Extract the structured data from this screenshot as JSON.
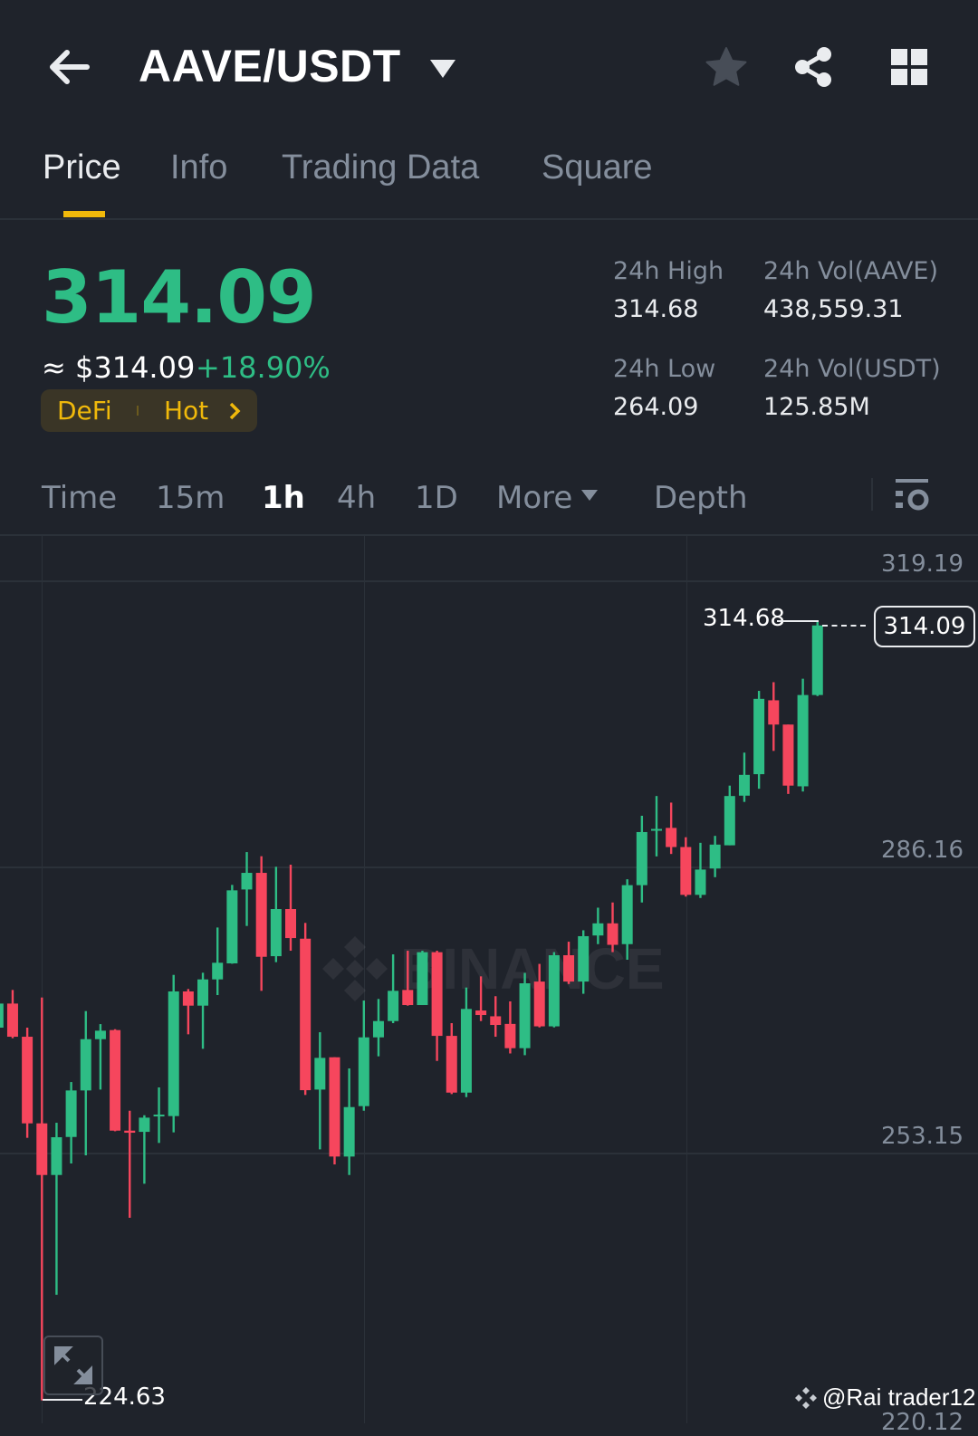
{
  "header": {
    "title": "AAVE/USDT",
    "icons": [
      "back-arrow-icon",
      "dropdown-caret-icon",
      "star-icon",
      "share-icon",
      "grid-icon"
    ]
  },
  "tabs": [
    {
      "label": "Price",
      "active": true
    },
    {
      "label": "Info"
    },
    {
      "label": "Trading Data"
    },
    {
      "label": "Square"
    }
  ],
  "ticker": {
    "last_price": "314.09",
    "approx_usd": "≈ $314.09",
    "change_pct": "+18.90%",
    "tags": [
      "DeFi",
      "Hot"
    ],
    "stats": {
      "high_label": "24h High",
      "high_value": "314.68",
      "low_label": "24h Low",
      "low_value": "264.09",
      "vol_base_label": "24h Vol(AAVE)",
      "vol_base_value": "438,559.31",
      "vol_quote_label": "24h Vol(USDT)",
      "vol_quote_value": "125.85M"
    }
  },
  "intervals": [
    {
      "label": "Time"
    },
    {
      "label": "15m"
    },
    {
      "label": "1h",
      "active": true
    },
    {
      "label": "4h"
    },
    {
      "label": "1D"
    },
    {
      "label": "More"
    },
    {
      "label": "Depth"
    }
  ],
  "colors": {
    "up": "#2ebd85",
    "down": "#f6465d",
    "accent": "#f0b90b",
    "bg": "#1f232b"
  },
  "chart": {
    "watermark": "BINANCE",
    "axis_labels": [
      "319.19",
      "286.16",
      "253.15",
      "220.12"
    ],
    "current_price_label": "314.09",
    "high_marker": "314.68",
    "low_marker": "224.63",
    "credit": "@Rai trader12"
  },
  "chart_data": {
    "type": "candlestick",
    "interval": "1h",
    "ylim": [
      220.12,
      321.5
    ],
    "y_ticks": [
      319.19,
      286.16,
      253.15,
      220.12
    ],
    "ohlc": [
      [
        267.66,
        270.44,
        267.66,
        270.44
      ],
      [
        270.44,
        272.01,
        266.44,
        266.61
      ],
      [
        266.61,
        267.66,
        254.94,
        256.61
      ],
      [
        256.61,
        271.14,
        224.63,
        250.65
      ],
      [
        250.65,
        256.68,
        236.82,
        255.01
      ],
      [
        255.04,
        261.38,
        251.98,
        260.41
      ],
      [
        260.41,
        269.57,
        252.92,
        266.33
      ],
      [
        266.33,
        268.07,
        260.51,
        267.31
      ],
      [
        267.38,
        267.48,
        255.7,
        255.77
      ],
      [
        255.77,
        258.07,
        245.71,
        255.53
      ],
      [
        255.63,
        257.55,
        249.64,
        257.27
      ],
      [
        257.45,
        260.76,
        254.35,
        257.62
      ],
      [
        257.45,
        273.75,
        255.57,
        271.84
      ],
      [
        271.84,
        272.12,
        266.89,
        270.2
      ],
      [
        270.2,
        274.0,
        265.22,
        273.23
      ],
      [
        273.23,
        279.22,
        271.42,
        275.15
      ],
      [
        275.08,
        284.14,
        275.04,
        283.51
      ],
      [
        283.61,
        287.93,
        279.4,
        285.53
      ],
      [
        285.53,
        287.45,
        271.91,
        275.84
      ],
      [
        275.91,
        286.23,
        275.22,
        281.35
      ],
      [
        281.35,
        286.47,
        276.54,
        278.0
      ],
      [
        277.93,
        279.75,
        259.89,
        260.44
      ],
      [
        260.51,
        267.13,
        253.61,
        264.17
      ],
      [
        264.24,
        264.24,
        251.87,
        252.78
      ],
      [
        252.78,
        262.95,
        250.65,
        258.49
      ],
      [
        258.6,
        270.79,
        258.07,
        266.54
      ],
      [
        266.54,
        270.97,
        264.35,
        268.42
      ],
      [
        268.42,
        276.12,
        268.18,
        271.91
      ],
      [
        272.01,
        276.54,
        270.2,
        270.27
      ],
      [
        270.27,
        276.54,
        270.27,
        276.37
      ],
      [
        276.37,
        276.54,
        263.82,
        266.71
      ],
      [
        266.71,
        268.18,
        259.99,
        260.16
      ],
      [
        260.16,
        272.29,
        259.64,
        269.82
      ],
      [
        269.64,
        273.58,
        268.42,
        269.12
      ],
      [
        268.97,
        271.29,
        266.61,
        267.97
      ],
      [
        268.09,
        270.69,
        264.68,
        265.29
      ],
      [
        265.29,
        273.98,
        264.48,
        272.78
      ],
      [
        272.98,
        275.02,
        267.69,
        267.81
      ],
      [
        267.81,
        276.38,
        267.69,
        276.02
      ],
      [
        276.02,
        277.58,
        272.7,
        272.98
      ],
      [
        272.98,
        278.9,
        271.57,
        278.22
      ],
      [
        278.3,
        281.51,
        277.3,
        279.7
      ],
      [
        279.7,
        282.11,
        276.38,
        277.22
      ],
      [
        277.3,
        284.79,
        275.5,
        284.11
      ],
      [
        284.11,
        292.12,
        282.11,
        290.24
      ],
      [
        290.44,
        294.4,
        287.43,
        290.6
      ],
      [
        290.72,
        293.64,
        287.71,
        288.51
      ],
      [
        288.51,
        289.64,
        282.79,
        282.99
      ],
      [
        282.99,
        289.0,
        282.63,
        285.91
      ],
      [
        286.03,
        289.8,
        285.03,
        288.79
      ],
      [
        288.71,
        295.6,
        288.71,
        294.4
      ],
      [
        294.44,
        299.41,
        293.72,
        296.84
      ],
      [
        296.92,
        306.54,
        295.24,
        305.62
      ],
      [
        305.45,
        307.54,
        299.61,
        302.65
      ],
      [
        302.65,
        302.65,
        294.64,
        295.6
      ],
      [
        295.52,
        307.94,
        294.92,
        306.06
      ],
      [
        306.06,
        314.68,
        305.94,
        314.09
      ]
    ]
  }
}
